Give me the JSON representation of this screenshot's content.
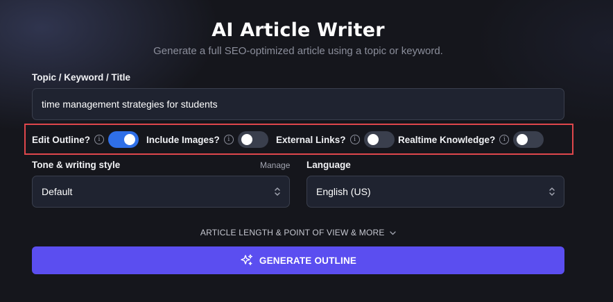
{
  "header": {
    "title": "AI Article Writer",
    "subtitle": "Generate a full SEO-optimized article using a topic or keyword."
  },
  "topic": {
    "label": "Topic / Keyword / Title",
    "value": "time management strategies for students"
  },
  "options": [
    {
      "label": "Edit Outline?",
      "enabled": true
    },
    {
      "label": "Include Images?",
      "enabled": false
    },
    {
      "label": "External Links?",
      "enabled": false
    },
    {
      "label": "Realtime Knowledge?",
      "enabled": false
    }
  ],
  "tone": {
    "label": "Tone & writing style",
    "manage_label": "Manage",
    "value": "Default"
  },
  "language": {
    "label": "Language",
    "value": "English (US)"
  },
  "more_options_label": "ARTICLE LENGTH & POINT OF VIEW & MORE",
  "generate_button_label": "GENERATE OUTLINE",
  "colors": {
    "toggle_on": "#2f6fe8",
    "toggle_off": "#3a3f4d",
    "primary_button": "#5b4ef0",
    "highlight_border": "#e0474c"
  },
  "icons": {
    "info": "info-circle-icon",
    "select": "chevron-up-down-icon",
    "expand": "chevron-down-icon",
    "generate": "sparkles-icon"
  }
}
